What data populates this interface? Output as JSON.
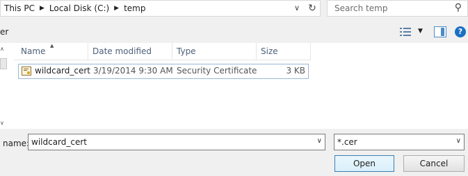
{
  "address": {
    "crumbs": [
      "This PC",
      "Local Disk (C:)",
      "temp"
    ],
    "icons": {
      "separator": "chevron-right-icon",
      "dropdown": "chevron-down-icon",
      "refresh": "refresh-icon"
    }
  },
  "search": {
    "placeholder": "Search temp",
    "icon": "search-icon"
  },
  "toolbar": {
    "cut_label": "er",
    "icons": [
      "view-details-icon",
      "chevron-down-icon",
      "preview-pane-icon",
      "help-icon"
    ]
  },
  "columns": [
    "Name",
    "Date modified",
    "Type",
    "Size"
  ],
  "files": [
    {
      "name": "wildcard_cert",
      "modified": "3/19/2014 9:30 AM",
      "type": "Security Certificate",
      "size": "3 KB",
      "icon": "certificate-icon"
    }
  ],
  "bottom": {
    "filename_label": "name:",
    "filename_value": "wildcard_cert",
    "filetype_value": "*.cer",
    "open_label": "Open",
    "cancel_label": "Cancel"
  },
  "colors": {
    "link_blue": "#1a6fc2",
    "header_text": "#4c607a",
    "selection_border": "#99b8d6"
  }
}
